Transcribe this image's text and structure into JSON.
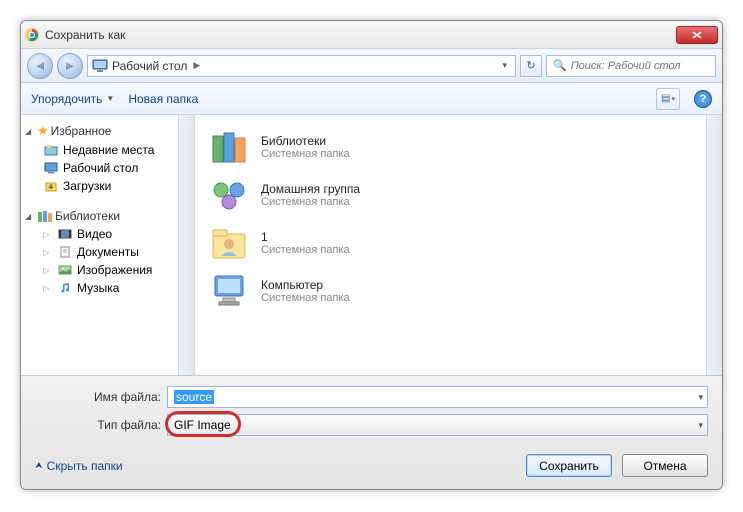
{
  "window": {
    "title": "Сохранить как"
  },
  "breadcrumb": {
    "location": "Рабочий стол"
  },
  "search": {
    "placeholder": "Поиск: Рабочий стол"
  },
  "toolbar": {
    "organize": "Упорядочить",
    "newfolder": "Новая папка"
  },
  "sidebar": {
    "favorites": {
      "label": "Избранное",
      "items": [
        {
          "label": "Недавние места"
        },
        {
          "label": "Рабочий стол"
        },
        {
          "label": "Загрузки"
        }
      ]
    },
    "libraries": {
      "label": "Библиотеки",
      "items": [
        {
          "label": "Видео"
        },
        {
          "label": "Документы"
        },
        {
          "label": "Изображения"
        },
        {
          "label": "Музыка"
        }
      ]
    }
  },
  "content": {
    "items": [
      {
        "name": "Библиотеки",
        "desc": "Системная папка"
      },
      {
        "name": "Домашняя группа",
        "desc": "Системная папка"
      },
      {
        "name": "1",
        "desc": "Системная папка"
      },
      {
        "name": "Компьютер",
        "desc": "Системная папка"
      }
    ]
  },
  "fields": {
    "name_label": "Имя файла:",
    "name_value": "source",
    "type_label": "Тип файла:",
    "type_value": "GIF Image"
  },
  "footer": {
    "hide": "Скрыть папки",
    "save": "Сохранить",
    "cancel": "Отмена"
  }
}
